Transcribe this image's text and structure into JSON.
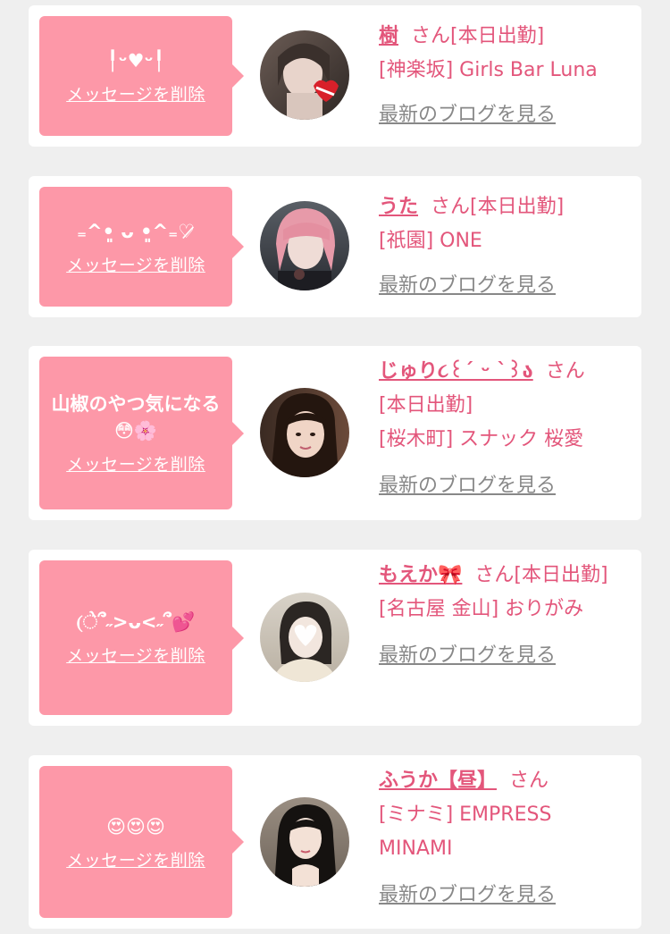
{
  "delete_label": "メッセージを削除",
  "blog_label": "最新のブログを見る",
  "honorific": "さん",
  "accent_color": "#e3567b",
  "bubble_color": "#fd98a8",
  "cards": [
    {
      "message": "╿ᵕ♥ᵕ╿",
      "name": "樹",
      "status": "[本日出勤]",
      "shop": "[神楽坂] Girls Bar Luna"
    },
    {
      "message": "₌^•͈ ᴗ •͈^₌♡̷",
      "name": "うた",
      "status": "[本日出勤]",
      "shop": "[祇園] ONE"
    },
    {
      "message": "山椒のやつ気になる😳🌸",
      "name": "じゅり૮꒰ˊ ᵕ ˋ꒱ა",
      "status": "[本日出勤]",
      "shop": "[桜木町] スナック 桜愛"
    },
    {
      "message": "(ે՞˶>ᴗ<˶՞💕",
      "name": "もえか🎀",
      "status": "[本日出勤]",
      "shop": "[名古屋 金山] おりがみ"
    },
    {
      "message": "😍😍😍",
      "name": "ふうか【昼】",
      "status": "",
      "shop": "[ミナミ] EMPRESS MINAMI"
    }
  ]
}
